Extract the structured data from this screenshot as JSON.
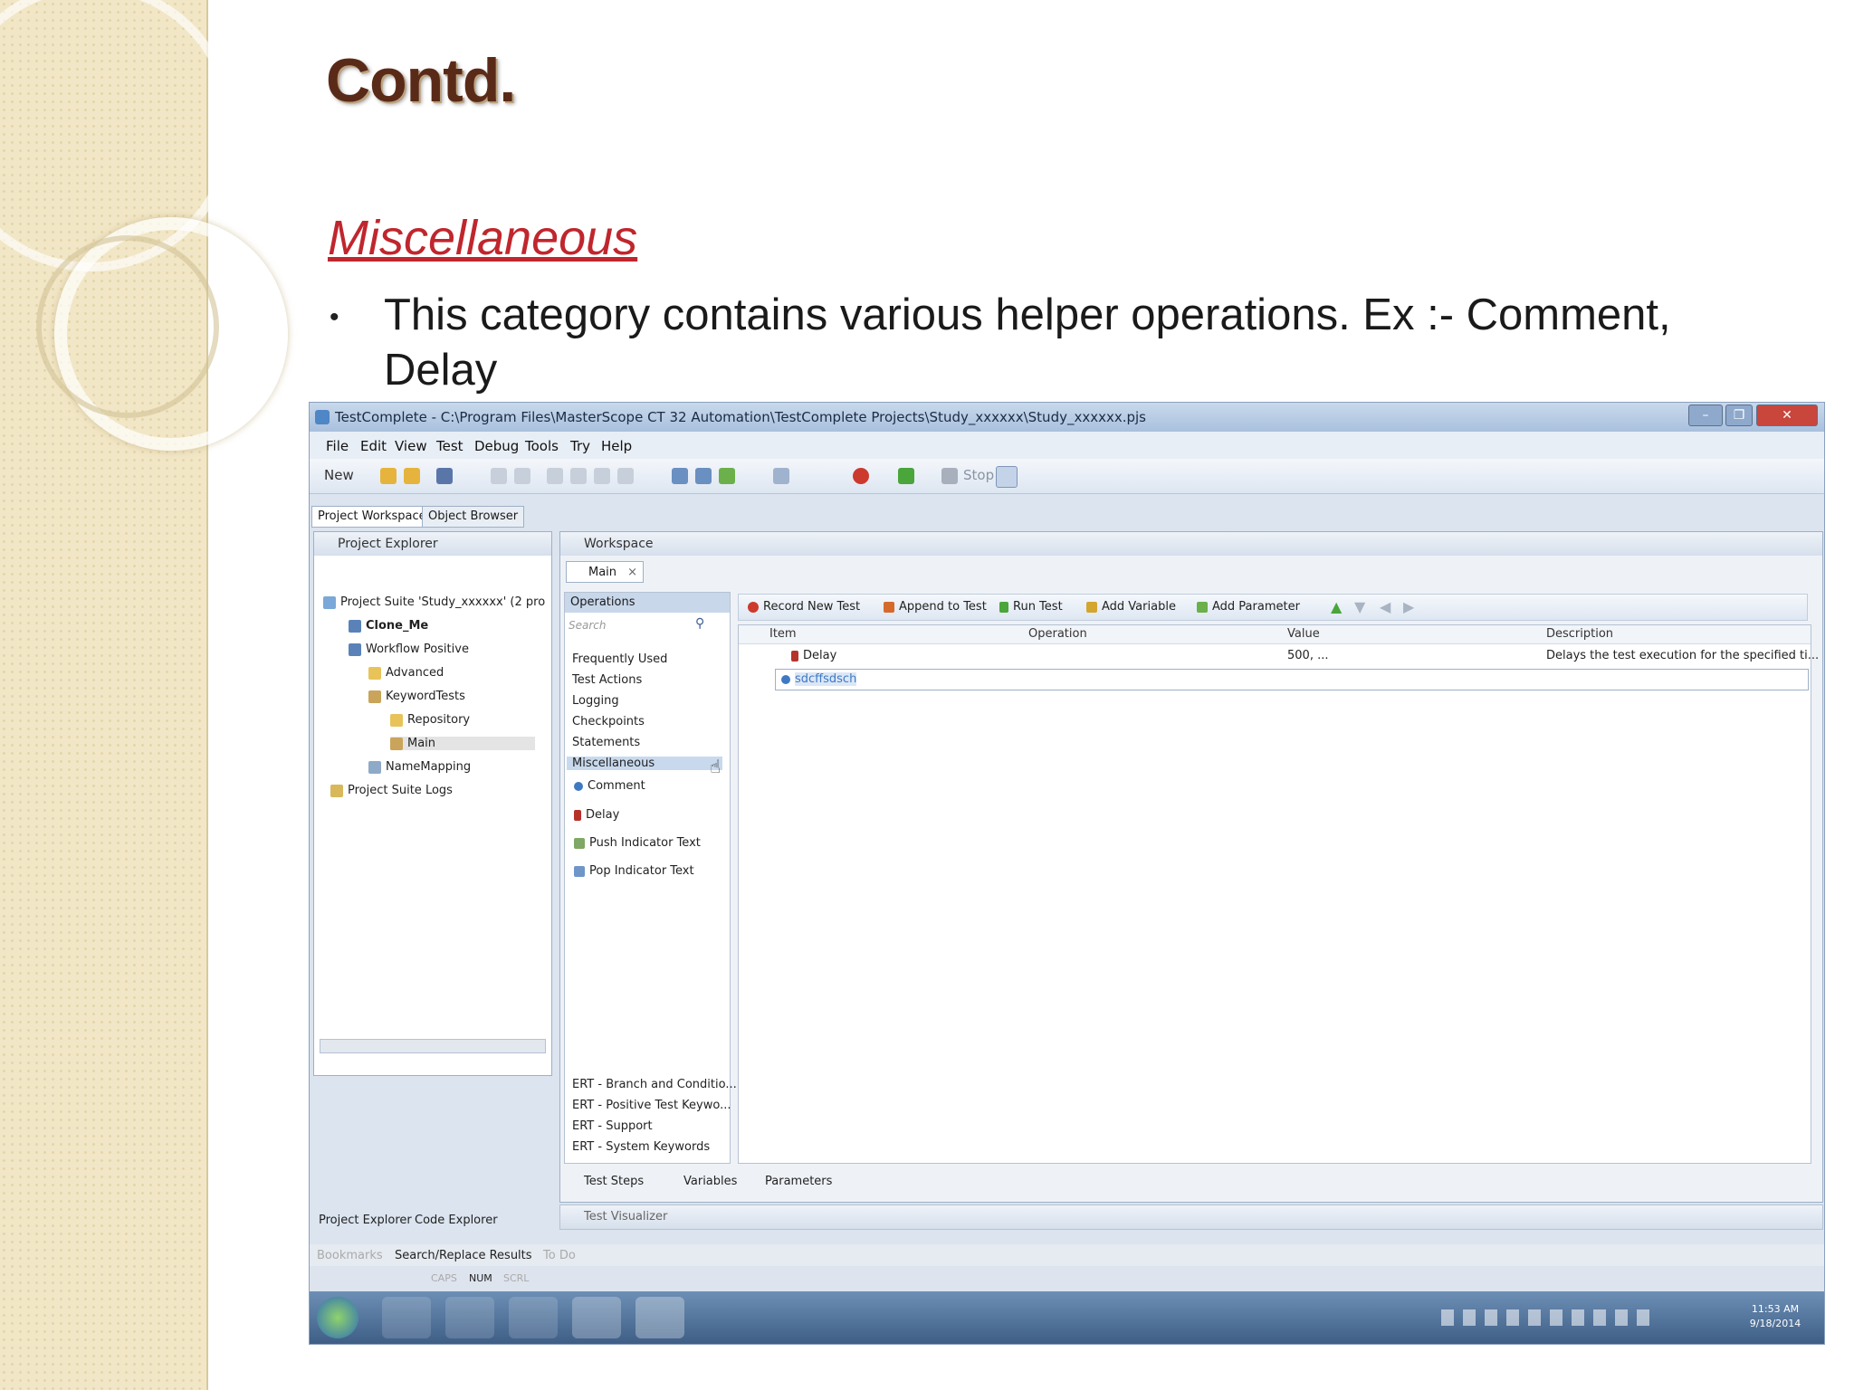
{
  "slide": {
    "title": "Contd.",
    "section_heading": "Miscellaneous",
    "bullet_text": "This category contains various helper operations. Ex :- Comment, Delay"
  },
  "window": {
    "title": "TestComplete - C:\\Program Files\\MasterScope CT 32 Automation\\TestComplete Projects\\Study_xxxxxx\\Study_xxxxxx.pjs"
  },
  "menu": [
    "File",
    "Edit",
    "View",
    "Test",
    "Debug",
    "Tools",
    "Try",
    "Help"
  ],
  "toolbar": {
    "new_label": "New",
    "stop_label": "Stop"
  },
  "workspace_tabs": {
    "project_workspace": "Project Workspace",
    "object_browser": "Object Browser"
  },
  "project_explorer": {
    "header": "Project Explorer",
    "items": [
      {
        "label": "Project Suite 'Study_xxxxxx' (2 pro"
      },
      {
        "label": "Clone_Me"
      },
      {
        "label": "Workflow Positive"
      },
      {
        "label": "Advanced"
      },
      {
        "label": "KeywordTests"
      },
      {
        "label": "Repository"
      },
      {
        "label": "Main"
      },
      {
        "label": "NameMapping"
      },
      {
        "label": "Project Suite Logs"
      }
    ],
    "bottom_tabs": {
      "project_explorer": "Project Explorer",
      "code_explorer": "Code Explorer"
    }
  },
  "workspace": {
    "header": "Workspace",
    "doc_tab": "Main",
    "operations_header": "Operations",
    "search_placeholder": "Search",
    "categories": [
      "Frequently Used",
      "Test Actions",
      "Logging",
      "Checkpoints",
      "Statements",
      "Miscellaneous"
    ],
    "misc_items": [
      "Comment",
      "Delay",
      "Push Indicator Text",
      "Pop Indicator Text"
    ],
    "ert_items": [
      "ERT - Branch and Conditio...",
      "ERT - Positive Test Keywo...",
      "ERT - Support",
      "ERT - System Keywords"
    ],
    "actions": [
      "Record New Test",
      "Append to Test",
      "Run Test",
      "Add Variable",
      "Add Parameter"
    ],
    "columns": [
      "Item",
      "Operation",
      "Value",
      "Description"
    ],
    "rows": [
      {
        "item": "Delay",
        "operation": "",
        "value": "500, ...",
        "description": "Delays the test execution for the specified ti..."
      },
      {
        "item": "sdcffsdsch",
        "operation": "",
        "value": "",
        "description": ""
      }
    ],
    "bottom_tabs": [
      "Test Steps",
      "Variables",
      "Parameters"
    ],
    "visualizer": "Test Visualizer"
  },
  "bottom_panel_tabs": [
    "Bookmarks",
    "Search/Replace Results",
    "To Do"
  ],
  "status_indicators": [
    "CAPS",
    "NUM",
    "SCRL"
  ],
  "clock": {
    "time": "11:53 AM",
    "date": "9/18/2014"
  }
}
